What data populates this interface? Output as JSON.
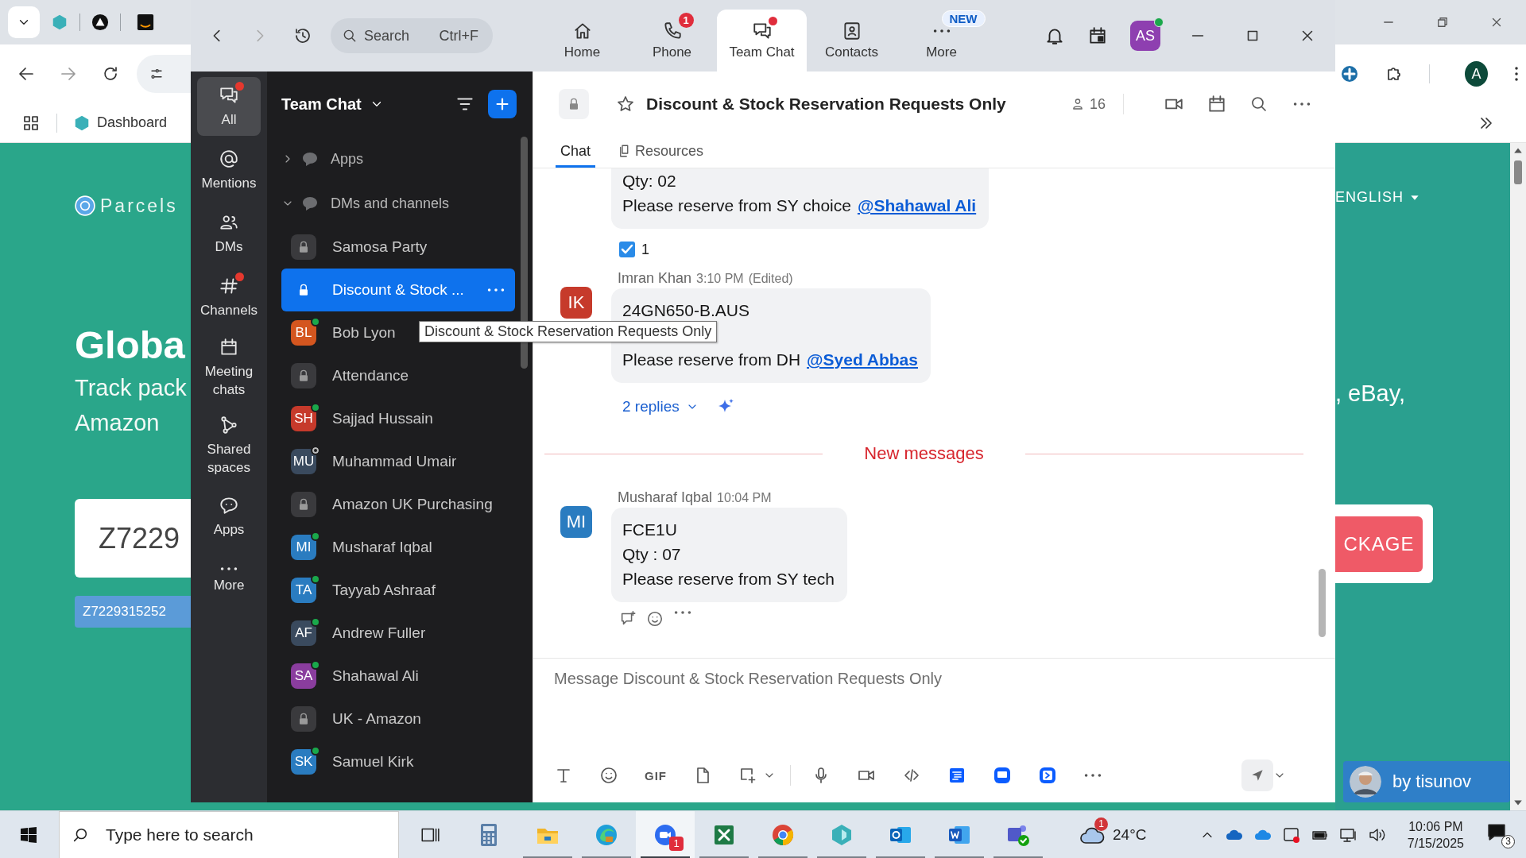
{
  "browser": {
    "bookmark": "Dashboard",
    "profile_initial": "A",
    "page": {
      "logo": "Parcels",
      "headline": "Globa",
      "subtitle_lines": [
        "Track pack",
        "Amazon"
      ],
      "tracking_input": "Z7229",
      "tracking_tag": "Z7229315252",
      "language": "ENGLISH",
      "subtitle_right": ", eBay,",
      "track_button": "CKAGE",
      "credit": "by tisunov"
    }
  },
  "zoom": {
    "search": {
      "placeholder": "Search",
      "shortcut": "Ctrl+F"
    },
    "nav_tabs": [
      {
        "label": "Home",
        "selected": false
      },
      {
        "label": "Phone",
        "selected": false,
        "badge": "1"
      },
      {
        "label": "Team Chat",
        "selected": true,
        "dot": true
      },
      {
        "label": "Contacts",
        "selected": false
      },
      {
        "label": "More",
        "selected": false,
        "tag": "NEW"
      }
    ],
    "user_avatar": {
      "initials": "AS",
      "color": "#8e3fb0",
      "online": true
    },
    "rail": [
      {
        "label": "All",
        "selected": true,
        "dot": true
      },
      {
        "label": "Mentions",
        "selected": false,
        "dot": false
      },
      {
        "label": "DMs",
        "selected": false,
        "dot": false
      },
      {
        "label": "Channels",
        "selected": false,
        "dot": true
      },
      {
        "label": "Meeting chats",
        "selected": false,
        "dot": false
      },
      {
        "label": "Shared spaces",
        "selected": false,
        "dot": false
      },
      {
        "label": "Apps",
        "selected": false,
        "dot": false
      },
      {
        "label": "More",
        "selected": false,
        "dot": false
      }
    ],
    "channel_list": {
      "title": "Team Chat",
      "sections": [
        {
          "label": "Apps",
          "expanded": false
        },
        {
          "label": "DMs and channels",
          "expanded": true
        }
      ],
      "items": [
        {
          "kind": "channel",
          "name": "Samosa Party",
          "selected": false
        },
        {
          "kind": "channel",
          "name": "Discount & Stock ...",
          "selected": true
        },
        {
          "kind": "person",
          "name": "Bob Lyon",
          "initials": "BL",
          "color": "#d4561f",
          "online": true,
          "selected": false
        },
        {
          "kind": "channel",
          "name": "Attendance",
          "selected": false
        },
        {
          "kind": "person",
          "name": "Sajjad Hussain",
          "initials": "SH",
          "color": "#c63a2b",
          "online": true,
          "selected": false
        },
        {
          "kind": "person",
          "name": "Muhammad Umair",
          "initials": "MU",
          "color": "#3a4a5e",
          "online": false,
          "selected": false
        },
        {
          "kind": "channel",
          "name": "Amazon UK Purchasing",
          "selected": false
        },
        {
          "kind": "person",
          "name": "Musharaf Iqbal",
          "initials": "MI",
          "color": "#2a7cc0",
          "online": true,
          "selected": false
        },
        {
          "kind": "person",
          "name": "Tayyab Ashraaf",
          "initials": "TA",
          "color": "#2a7cc0",
          "online": true,
          "selected": false
        },
        {
          "kind": "person",
          "name": "Andrew Fuller",
          "initials": "AF",
          "color": "#3a4a5e",
          "online": true,
          "selected": false
        },
        {
          "kind": "person",
          "name": "Shahawal Ali",
          "initials": "SA",
          "color": "#8a3d9e",
          "online": true,
          "selected": false
        },
        {
          "kind": "channel",
          "name": "UK - Amazon",
          "selected": false
        },
        {
          "kind": "person",
          "name": "Samuel Kirk",
          "initials": "SK",
          "color": "#2a7cc0",
          "online": true,
          "selected": false
        }
      ]
    },
    "tooltip": "Discount & Stock Reservation Requests Only",
    "chat": {
      "title": "Discount & Stock Reservation Requests Only",
      "member_count": "16",
      "tabs": [
        {
          "label": "Chat",
          "selected": true
        },
        {
          "label": "Resources",
          "selected": false
        }
      ],
      "messages": [
        {
          "kind": "continued",
          "lines": [
            {
              "text": "Qty: 02"
            },
            {
              "text": "Please reserve from SY choice",
              "mention": "@Shahawal Ali"
            }
          ],
          "reaction": {
            "count": "1"
          }
        },
        {
          "kind": "message",
          "author": "Imran Khan",
          "initials": "IK",
          "color": "#c63a2b",
          "time": "3:10 PM",
          "edited": "(Edited)",
          "covered_line": true,
          "lines": [
            {
              "text": "24GN650-B.AUS"
            },
            {
              "text": "Please reserve from DH",
              "mention": "@Syed Abbas"
            }
          ],
          "replies": "2 replies"
        },
        {
          "kind": "divider",
          "label": "New messages"
        },
        {
          "kind": "message",
          "author": "Musharaf Iqbal",
          "initials": "MI",
          "color": "#2a7cc0",
          "time": "10:04 PM",
          "lines": [
            {
              "text": "FCE1U"
            },
            {
              "text": "Qty : 07"
            },
            {
              "text": "Please reserve from SY tech"
            }
          ],
          "hover_actions": true
        }
      ],
      "composer": {
        "placeholder": "Message Discount & Stock Reservation Requests Only",
        "gif": "GIF"
      }
    }
  },
  "taskbar": {
    "search_placeholder": "Type here to search",
    "apps": [
      {
        "running": false,
        "active": false
      },
      {
        "running": true,
        "active": false
      },
      {
        "running": true,
        "active": false
      },
      {
        "running": true,
        "active": true,
        "badge": "1"
      },
      {
        "running": true,
        "active": false
      },
      {
        "running": true,
        "active": false
      },
      {
        "running": true,
        "active": false
      },
      {
        "running": true,
        "active": false
      },
      {
        "running": true,
        "active": false
      },
      {
        "running": true,
        "active": false
      }
    ],
    "weather": {
      "badge": "1",
      "temperature": "24°C"
    },
    "clock": {
      "time": "10:06 PM",
      "date": "7/15/2025"
    },
    "notifications": "3"
  }
}
